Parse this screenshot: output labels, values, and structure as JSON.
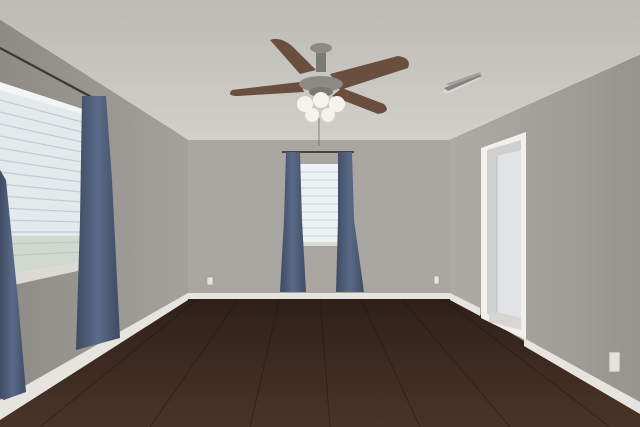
{
  "scene": {
    "subject": "empty-bedroom-interior",
    "colors": {
      "ceiling": "#c9c7c2",
      "wall_back": "#a9a6a1",
      "wall_left": "#9a9792",
      "wall_right": "#a29f9a",
      "floor": "#3b2a21",
      "baseboard": "#e6e4df",
      "curtain": "#4f5d78",
      "window_glass": "#eef2f4",
      "door": "#d9dbdc",
      "fan_blade": "#6a4e3e",
      "fan_metal": "#8d8a86",
      "light_glass": "#f6f3ec"
    },
    "icons": [
      "ceiling-fan-icon",
      "air-vent-icon",
      "power-outlet-icon"
    ]
  }
}
